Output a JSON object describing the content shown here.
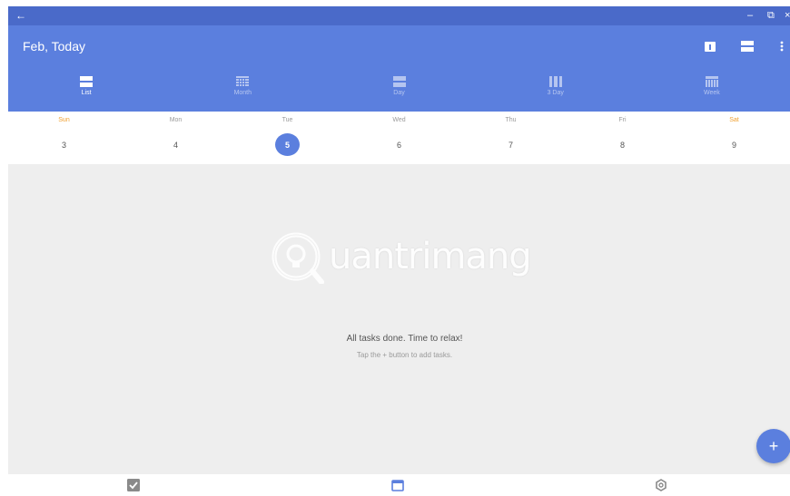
{
  "window": {
    "back_glyph": "←",
    "minimize_glyph": "–",
    "restore_glyph": "⧉",
    "close_glyph": "×"
  },
  "header": {
    "title": "Feb, Today",
    "toolbar_icons": [
      "calendar-today-icon",
      "view-toggle-icon",
      "more-vert-icon"
    ]
  },
  "tabs": [
    {
      "label": "List",
      "icon": "list-icon",
      "active": true
    },
    {
      "label": "Month",
      "icon": "month-icon",
      "active": false
    },
    {
      "label": "Day",
      "icon": "day-icon",
      "active": false
    },
    {
      "label": "3 Day",
      "icon": "three-day-icon",
      "active": false
    },
    {
      "label": "Week",
      "icon": "week-icon",
      "active": false
    }
  ],
  "week": [
    {
      "name": "Sun",
      "num": "3",
      "weekend": true
    },
    {
      "name": "Mon",
      "num": "4"
    },
    {
      "name": "Tue",
      "num": "5",
      "today": true
    },
    {
      "name": "Wed",
      "num": "6"
    },
    {
      "name": "Thu",
      "num": "7"
    },
    {
      "name": "Fri",
      "num": "8"
    },
    {
      "name": "Sat",
      "num": "9",
      "weekend": true
    }
  ],
  "empty_state": {
    "title": "All tasks done. Time to relax!",
    "subtitle": "Tap the + button to add tasks."
  },
  "watermark": {
    "text": "uantrimang"
  },
  "fab": {
    "label": "+"
  },
  "bottom_nav": [
    "tasks-checkbox-icon",
    "calendar-icon",
    "settings-icon"
  ],
  "colors": {
    "primary": "#5b7fde",
    "titlebar": "#4a6ac9",
    "weekend": "#f0a030",
    "background": "#eeeeee"
  }
}
